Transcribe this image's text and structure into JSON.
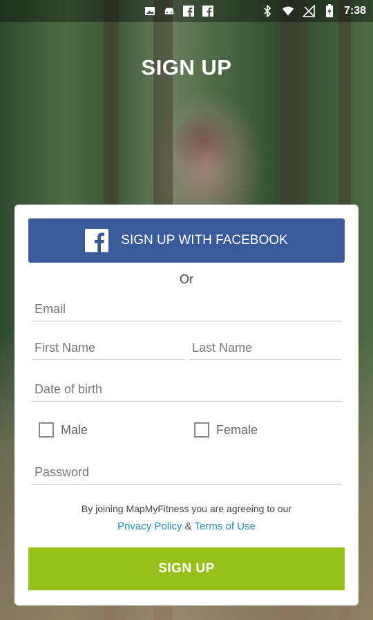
{
  "status_bar": {
    "time": "7:38",
    "left_icons": [
      "image-icon",
      "car-icon",
      "facebook-icon",
      "facebook-icon"
    ],
    "right_icons": [
      "bluetooth-icon",
      "wifi-icon",
      "no-signal-icon",
      "battery-charging-icon"
    ]
  },
  "header": {
    "title": "SIGN UP"
  },
  "form": {
    "facebook_button_label": "SIGN UP WITH FACEBOOK",
    "or_label": "Or",
    "email_placeholder": "Email",
    "first_name_placeholder": "First Name",
    "last_name_placeholder": "Last Name",
    "dob_placeholder": "Date of birth",
    "gender_male_label": "Male",
    "gender_female_label": "Female",
    "password_placeholder": "Password",
    "terms_text": "By joining MapMyFitness you are agreeing to our",
    "privacy_link": "Privacy Policy",
    "terms_separator": "&",
    "terms_link": "Terms of Use",
    "signup_button_label": "SIGN UP"
  },
  "colors": {
    "facebook_blue": "#3b5a9a",
    "signup_green": "#97c01a",
    "link_color": "#2a8aa8"
  }
}
